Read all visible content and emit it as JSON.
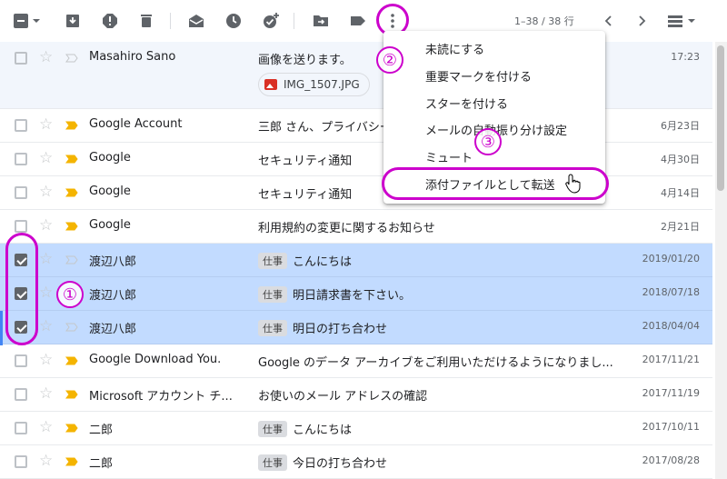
{
  "toolbar": {
    "icons": [
      "select-checkbox-icon",
      "archive-icon",
      "report-spam-icon",
      "delete-icon",
      "mark-read-icon",
      "snooze-icon",
      "add-task-icon",
      "move-to-icon",
      "label-icon",
      "more-vert-icon"
    ],
    "pager": "1–38 / 38 行"
  },
  "menu": {
    "items": [
      "未読にする",
      "重要マークを付ける",
      "スターを付ける",
      "メールの自動振り分け設定",
      "ミュート",
      "添付ファイルとして転送"
    ]
  },
  "annotations": [
    "①",
    "②",
    "③"
  ],
  "rows": [
    {
      "sender": "Masahiro Sano",
      "subject": "画像を送ります。",
      "date": "17:23",
      "attachment": "IMG_1507.JPG",
      "checked": false,
      "important": false
    },
    {
      "sender": "Google Account",
      "subject": "三郎 さん、プライバシー",
      "date": "6月23日",
      "checked": false,
      "important": true
    },
    {
      "sender": "Google",
      "subject": "セキュリティ通知",
      "date": "4月30日",
      "checked": false,
      "important": true
    },
    {
      "sender": "Google",
      "subject": "セキュリティ通知",
      "date": "4月14日",
      "checked": false,
      "important": true
    },
    {
      "sender": "Google",
      "subject": "利用規約の変更に関するお知らせ",
      "date": "2月21日",
      "checked": false,
      "important": true
    },
    {
      "sender": "渡辺八郎",
      "tag": "仕事",
      "subject": "こんにちは",
      "date": "2019/01/20",
      "checked": true,
      "important": false
    },
    {
      "sender": "渡辺八郎",
      "tag": "仕事",
      "subject": "明日請求書を下さい。",
      "date": "2018/07/18",
      "checked": true,
      "important": false
    },
    {
      "sender": "渡辺八郎",
      "tag": "仕事",
      "subject": "明日の打ち合わせ",
      "date": "2018/04/04",
      "checked": true,
      "important": false
    },
    {
      "sender": "Google Download You.",
      "subject": "Google のデータ アーカイブをご利用いただけるようになりまし...",
      "date": "2017/11/21",
      "checked": false,
      "important": true
    },
    {
      "sender": "Microsoft アカウント チ...",
      "subject": "お使いのメール アドレスの確認",
      "date": "2017/11/19",
      "checked": false,
      "important": true
    },
    {
      "sender": "二郎",
      "tag": "仕事",
      "subject": "こんにちは",
      "date": "2017/10/11",
      "checked": false,
      "important": true
    },
    {
      "sender": "二郎",
      "tag": "仕事",
      "subject": "今日の打ち合わせ",
      "date": "2017/08/28",
      "checked": false,
      "important": true
    }
  ],
  "colors": {
    "accent": "#cc00cc",
    "selected": "#c2dbff",
    "important": "#f4b400"
  }
}
